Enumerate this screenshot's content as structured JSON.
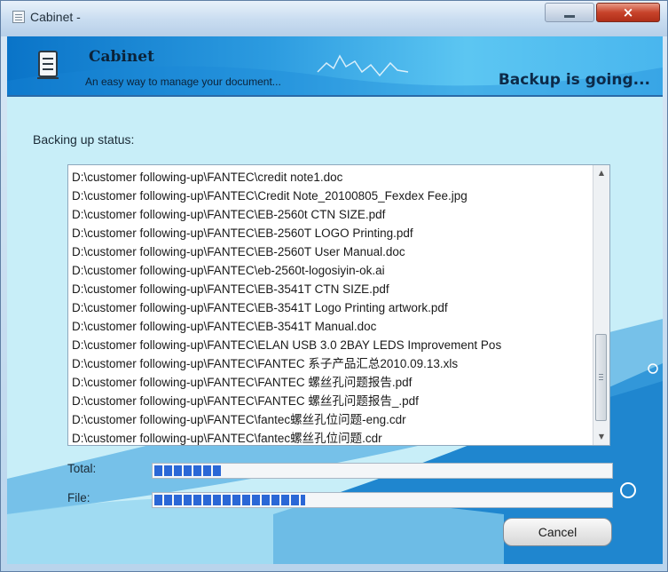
{
  "window": {
    "title": "Cabinet -",
    "close_label": "×"
  },
  "header": {
    "app_name": "Cabinet",
    "subtitle": "An easy way to manage your document...",
    "status": "Backup is going..."
  },
  "main": {
    "status_label": "Backing up status:",
    "files": [
      "D:\\customer following-up\\FANTEC\\credit note1.doc",
      "D:\\customer following-up\\FANTEC\\Credit Note_20100805_Fexdex Fee.jpg",
      "D:\\customer following-up\\FANTEC\\EB-2560t  CTN SIZE.pdf",
      "D:\\customer following-up\\FANTEC\\EB-2560T LOGO Printing.pdf",
      "D:\\customer following-up\\FANTEC\\EB-2560T User Manual.doc",
      "D:\\customer following-up\\FANTEC\\eb-2560t-logosiyin-ok.ai",
      "D:\\customer following-up\\FANTEC\\EB-3541T CTN SIZE.pdf",
      "D:\\customer following-up\\FANTEC\\EB-3541T Logo Printing artwork.pdf",
      "D:\\customer following-up\\FANTEC\\EB-3541T Manual.doc",
      "D:\\customer following-up\\FANTEC\\ELAN USB 3.0 2BAY LEDS Improvement Pos",
      "D:\\customer following-up\\FANTEC\\FANTEC 系子产品汇总2010.09.13.xls",
      "D:\\customer following-up\\FANTEC\\FANTEC 螺丝孔问题报告.pdf",
      "D:\\customer following-up\\FANTEC\\FANTEC 螺丝孔问题报告_.pdf",
      "D:\\customer following-up\\FANTEC\\fantec螺丝孔位问题-eng.cdr",
      "D:\\customer following-up\\FANTEC\\fantec螺丝孔位问题.cdr"
    ],
    "total_label": "Total:",
    "total_progress": 0.15,
    "file_label": "File:",
    "file_progress": 0.33,
    "cancel_label": "Cancel"
  },
  "colors": {
    "header_start": "#0a74c8",
    "header_end": "#5cc6f2",
    "content_bg": "#c8eef8",
    "progress_fill": "#2a67d6",
    "close_button": "#c7432b"
  },
  "icons": {
    "app_icon": "cabinet-icon",
    "scroll_up": "arrow-up-icon",
    "scroll_down": "arrow-down-icon"
  }
}
